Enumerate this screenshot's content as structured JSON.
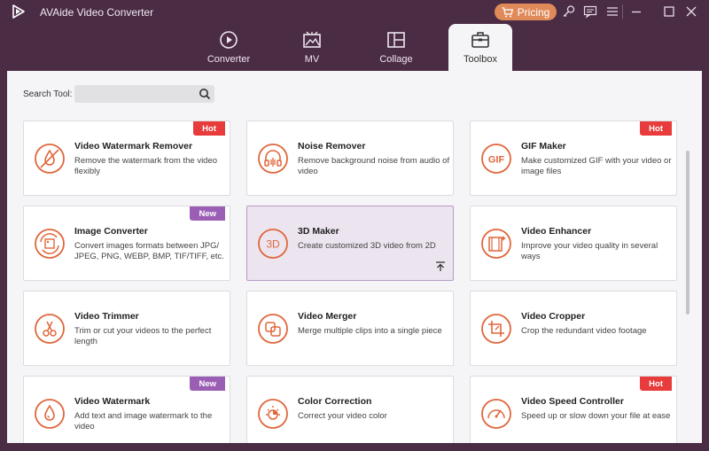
{
  "app": {
    "title": "AVAide Video Converter",
    "pricing_label": "Pricing"
  },
  "tabs": [
    {
      "label": "Converter",
      "icon": "converter-icon"
    },
    {
      "label": "MV",
      "icon": "mv-icon"
    },
    {
      "label": "Collage",
      "icon": "collage-icon"
    },
    {
      "label": "Toolbox",
      "icon": "toolbox-icon",
      "active": true
    }
  ],
  "search": {
    "label": "Search Tool:",
    "placeholder": ""
  },
  "colors": {
    "accent": "#e0673c",
    "hot": "#e83b3b",
    "new": "#9a5fb4",
    "chrome": "#4a2c45"
  },
  "tools": [
    {
      "title": "Video Watermark Remover",
      "desc": "Remove the watermark from the video flexibly",
      "badge": "Hot",
      "icon": "watermark-remover-icon"
    },
    {
      "title": "Noise Remover",
      "desc": "Remove background noise from audio of video",
      "badge": "",
      "icon": "noise-remover-icon"
    },
    {
      "title": "GIF Maker",
      "desc": "Make customized GIF with your video or image files",
      "badge": "Hot",
      "icon": "gif-maker-icon"
    },
    {
      "title": "Image Converter",
      "desc": "Convert images formats between JPG/ JPEG, PNG, WEBP, BMP, TIF/TIFF, etc.",
      "badge": "New",
      "icon": "image-converter-icon"
    },
    {
      "title": "3D Maker",
      "desc": "Create customized 3D video from 2D",
      "badge": "",
      "icon": "3d-maker-icon"
    },
    {
      "title": "Video Enhancer",
      "desc": "Improve your video quality in several ways",
      "badge": "",
      "icon": "video-enhancer-icon"
    },
    {
      "title": "Video Trimmer",
      "desc": "Trim or cut your videos to the perfect length",
      "badge": "",
      "icon": "video-trimmer-icon"
    },
    {
      "title": "Video Merger",
      "desc": "Merge multiple clips into a single piece",
      "badge": "",
      "icon": "video-merger-icon"
    },
    {
      "title": "Video Cropper",
      "desc": "Crop the redundant video footage",
      "badge": "",
      "icon": "video-cropper-icon"
    },
    {
      "title": "Video Watermark",
      "desc": "Add text and image watermark to the video",
      "badge": "New",
      "icon": "video-watermark-icon"
    },
    {
      "title": "Color Correction",
      "desc": "Correct your video color",
      "badge": "",
      "icon": "color-correction-icon"
    },
    {
      "title": "Video Speed Controller",
      "desc": "Speed up or slow down your file at ease",
      "badge": "Hot",
      "icon": "speed-controller-icon"
    }
  ]
}
